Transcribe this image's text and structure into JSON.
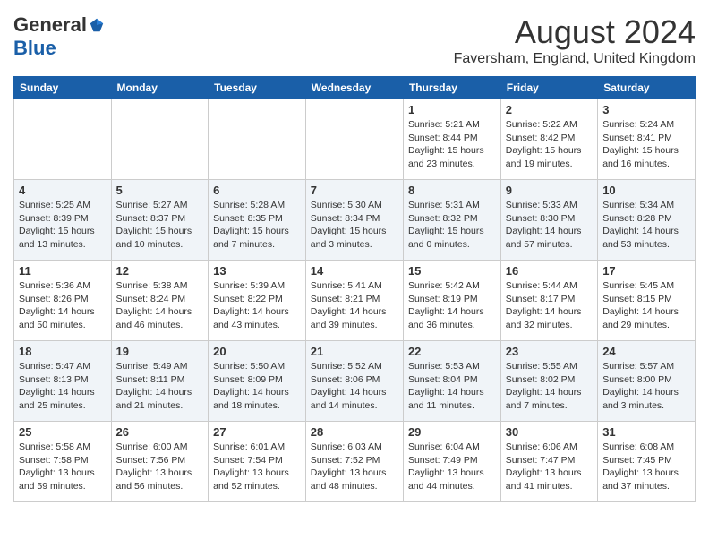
{
  "header": {
    "logo_general": "General",
    "logo_blue": "Blue",
    "month": "August 2024",
    "location": "Faversham, England, United Kingdom"
  },
  "weekdays": [
    "Sunday",
    "Monday",
    "Tuesday",
    "Wednesday",
    "Thursday",
    "Friday",
    "Saturday"
  ],
  "weeks": [
    [
      {
        "day": "",
        "info": ""
      },
      {
        "day": "",
        "info": ""
      },
      {
        "day": "",
        "info": ""
      },
      {
        "day": "",
        "info": ""
      },
      {
        "day": "1",
        "info": "Sunrise: 5:21 AM\nSunset: 8:44 PM\nDaylight: 15 hours\nand 23 minutes."
      },
      {
        "day": "2",
        "info": "Sunrise: 5:22 AM\nSunset: 8:42 PM\nDaylight: 15 hours\nand 19 minutes."
      },
      {
        "day": "3",
        "info": "Sunrise: 5:24 AM\nSunset: 8:41 PM\nDaylight: 15 hours\nand 16 minutes."
      }
    ],
    [
      {
        "day": "4",
        "info": "Sunrise: 5:25 AM\nSunset: 8:39 PM\nDaylight: 15 hours\nand 13 minutes."
      },
      {
        "day": "5",
        "info": "Sunrise: 5:27 AM\nSunset: 8:37 PM\nDaylight: 15 hours\nand 10 minutes."
      },
      {
        "day": "6",
        "info": "Sunrise: 5:28 AM\nSunset: 8:35 PM\nDaylight: 15 hours\nand 7 minutes."
      },
      {
        "day": "7",
        "info": "Sunrise: 5:30 AM\nSunset: 8:34 PM\nDaylight: 15 hours\nand 3 minutes."
      },
      {
        "day": "8",
        "info": "Sunrise: 5:31 AM\nSunset: 8:32 PM\nDaylight: 15 hours\nand 0 minutes."
      },
      {
        "day": "9",
        "info": "Sunrise: 5:33 AM\nSunset: 8:30 PM\nDaylight: 14 hours\nand 57 minutes."
      },
      {
        "day": "10",
        "info": "Sunrise: 5:34 AM\nSunset: 8:28 PM\nDaylight: 14 hours\nand 53 minutes."
      }
    ],
    [
      {
        "day": "11",
        "info": "Sunrise: 5:36 AM\nSunset: 8:26 PM\nDaylight: 14 hours\nand 50 minutes."
      },
      {
        "day": "12",
        "info": "Sunrise: 5:38 AM\nSunset: 8:24 PM\nDaylight: 14 hours\nand 46 minutes."
      },
      {
        "day": "13",
        "info": "Sunrise: 5:39 AM\nSunset: 8:22 PM\nDaylight: 14 hours\nand 43 minutes."
      },
      {
        "day": "14",
        "info": "Sunrise: 5:41 AM\nSunset: 8:21 PM\nDaylight: 14 hours\nand 39 minutes."
      },
      {
        "day": "15",
        "info": "Sunrise: 5:42 AM\nSunset: 8:19 PM\nDaylight: 14 hours\nand 36 minutes."
      },
      {
        "day": "16",
        "info": "Sunrise: 5:44 AM\nSunset: 8:17 PM\nDaylight: 14 hours\nand 32 minutes."
      },
      {
        "day": "17",
        "info": "Sunrise: 5:45 AM\nSunset: 8:15 PM\nDaylight: 14 hours\nand 29 minutes."
      }
    ],
    [
      {
        "day": "18",
        "info": "Sunrise: 5:47 AM\nSunset: 8:13 PM\nDaylight: 14 hours\nand 25 minutes."
      },
      {
        "day": "19",
        "info": "Sunrise: 5:49 AM\nSunset: 8:11 PM\nDaylight: 14 hours\nand 21 minutes."
      },
      {
        "day": "20",
        "info": "Sunrise: 5:50 AM\nSunset: 8:09 PM\nDaylight: 14 hours\nand 18 minutes."
      },
      {
        "day": "21",
        "info": "Sunrise: 5:52 AM\nSunset: 8:06 PM\nDaylight: 14 hours\nand 14 minutes."
      },
      {
        "day": "22",
        "info": "Sunrise: 5:53 AM\nSunset: 8:04 PM\nDaylight: 14 hours\nand 11 minutes."
      },
      {
        "day": "23",
        "info": "Sunrise: 5:55 AM\nSunset: 8:02 PM\nDaylight: 14 hours\nand 7 minutes."
      },
      {
        "day": "24",
        "info": "Sunrise: 5:57 AM\nSunset: 8:00 PM\nDaylight: 14 hours\nand 3 minutes."
      }
    ],
    [
      {
        "day": "25",
        "info": "Sunrise: 5:58 AM\nSunset: 7:58 PM\nDaylight: 13 hours\nand 59 minutes."
      },
      {
        "day": "26",
        "info": "Sunrise: 6:00 AM\nSunset: 7:56 PM\nDaylight: 13 hours\nand 56 minutes."
      },
      {
        "day": "27",
        "info": "Sunrise: 6:01 AM\nSunset: 7:54 PM\nDaylight: 13 hours\nand 52 minutes."
      },
      {
        "day": "28",
        "info": "Sunrise: 6:03 AM\nSunset: 7:52 PM\nDaylight: 13 hours\nand 48 minutes."
      },
      {
        "day": "29",
        "info": "Sunrise: 6:04 AM\nSunset: 7:49 PM\nDaylight: 13 hours\nand 44 minutes."
      },
      {
        "day": "30",
        "info": "Sunrise: 6:06 AM\nSunset: 7:47 PM\nDaylight: 13 hours\nand 41 minutes."
      },
      {
        "day": "31",
        "info": "Sunrise: 6:08 AM\nSunset: 7:45 PM\nDaylight: 13 hours\nand 37 minutes."
      }
    ]
  ]
}
